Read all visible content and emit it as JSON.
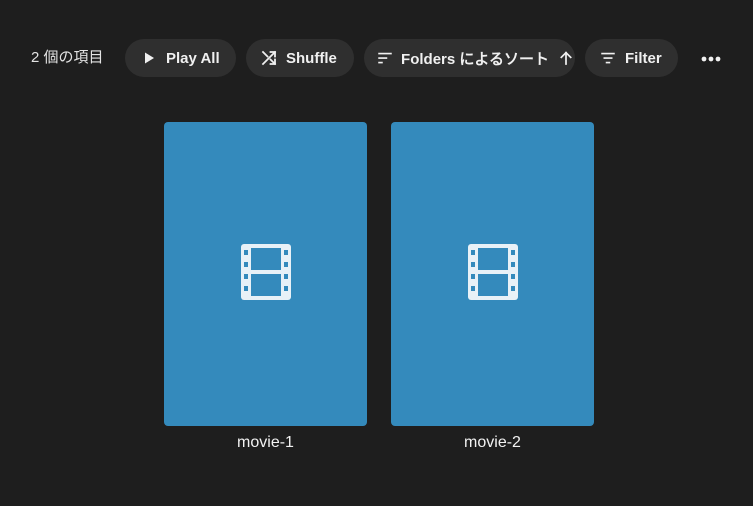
{
  "toolbar": {
    "item_count": "2 個の項目",
    "play_all_label": "Play All",
    "shuffle_label": "Shuffle",
    "sort_label": "Folders によるソート",
    "filter_label": "Filter",
    "icons": {
      "play": "play-icon",
      "shuffle": "shuffle-icon",
      "sort": "sort-icon",
      "sort_direction": "arrow-up-icon",
      "filter": "filter-icon",
      "more": "more-horizontal-icon"
    }
  },
  "items": [
    {
      "title": "movie-1",
      "icon": "film-icon",
      "poster_color": "#348abc"
    },
    {
      "title": "movie-2",
      "icon": "film-icon",
      "poster_color": "#348abc"
    }
  ],
  "colors": {
    "background": "#1e1e1e",
    "pill_background": "#2f2f2f",
    "poster_icon": "#e8f1f7"
  }
}
